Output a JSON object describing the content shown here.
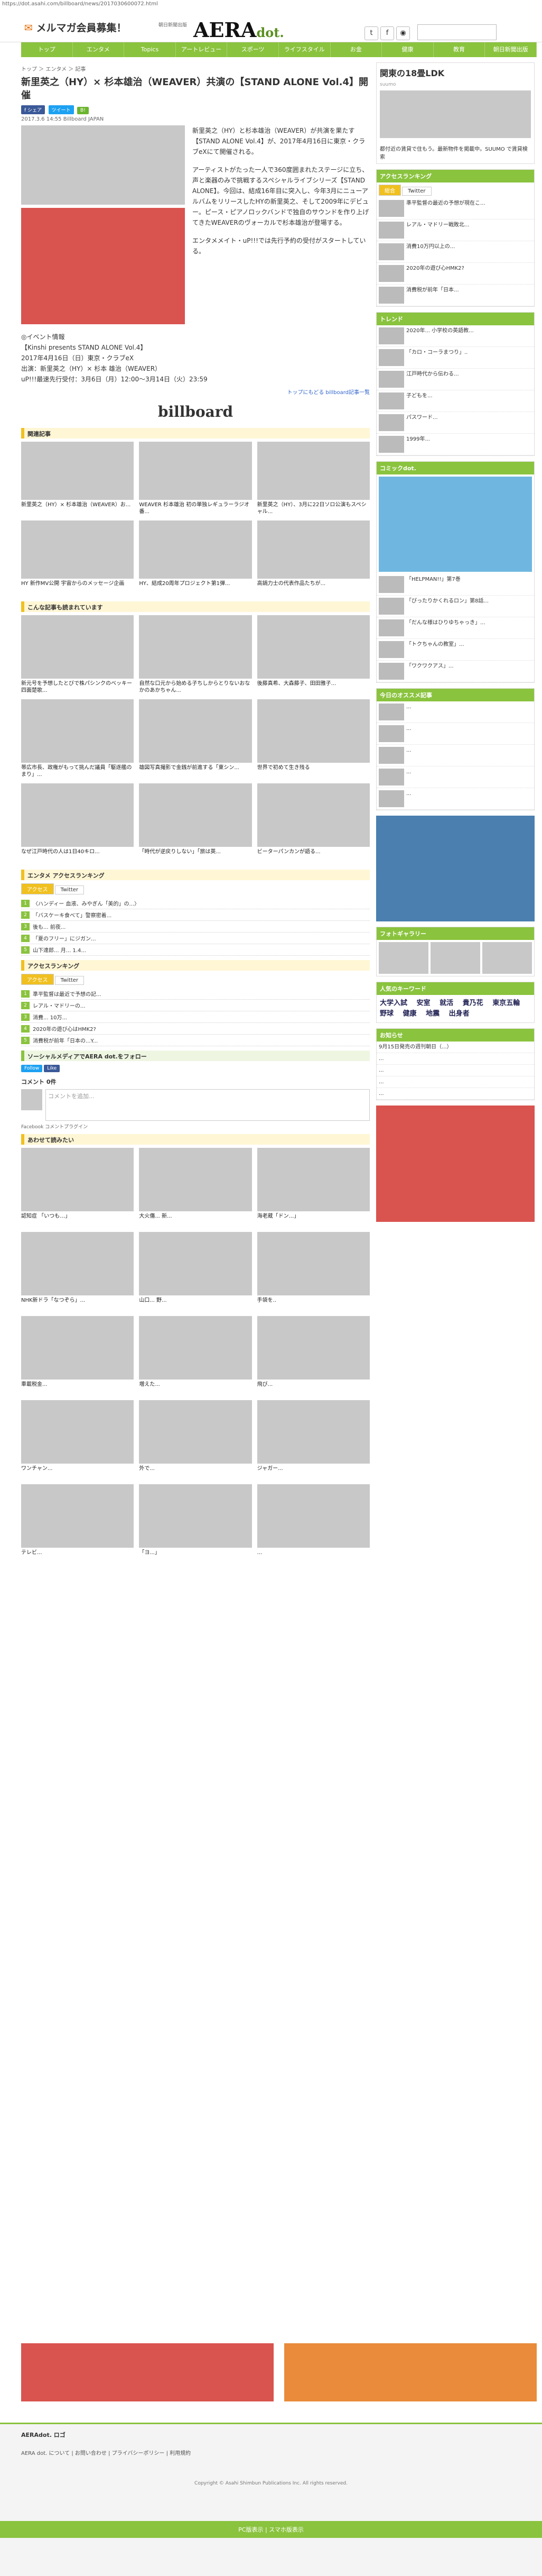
{
  "url": "https://dot.asahi.com/billboard/news/2017030600072.html",
  "header": {
    "mail_logo": "メルマガ会員募集！",
    "mid": "朝日新聞出版",
    "aera": "AERA",
    "dot": "dot."
  },
  "nav": [
    "トップ",
    "エンタメ",
    "Topics",
    "アートレビュー",
    "スポーツ",
    "ライフスタイル",
    "お金",
    "健康",
    "教育",
    "朝日新聞出版"
  ],
  "breadcrumb": "トップ ＞ エンタメ ＞ 記事",
  "article": {
    "title": "新里英之（HY）× 杉本雄治（WEAVER）共演の【STAND ALONE Vol.4】開催",
    "date": "2017.3.6 14:55 Billboard JAPAN",
    "p1": "新里英之（HY）と杉本雄治（WEAVER）が共演を果たす【STAND ALONE Vol.4】が、2017年4月16日に東京・クラブeXにて開催される。",
    "p2": "アーティストがたった一人で360度囲まれたステージに立ち、声と楽器のみで挑戦するスペシャルライブシリーズ【STAND ALONE】。今回は、結成16年目に突入し、今年3月にニューアルバムをリリースしたHYの新里英之、そして2009年にデビュー。ピース・ピアノロックバンドで独自のサウンドを作り上げてきたWEAVERのヴォーカルで杉本雄治が登場する。",
    "p3": "エンタメメイト・uP!!!では先行予約の受付がスタートしている。",
    "info": [
      "◎イベント情報",
      "【Kinshi presents STAND ALONE Vol.4】",
      "2017年4月16日（日）東京・クラブeX",
      "出演：新里英之（HY）× 杉本 雄治（WEAVER）",
      "uP!!!最速先行受付：3月6日（月）12:00〜3月14日（火）23:59"
    ],
    "more": "トップにもどる billboard記事一覧",
    "bb": "billboard"
  },
  "sec_related": "関連記事",
  "related": [
    "新里英之（HY）× 杉本雄治（WEAVER）お...",
    "WEAVER 杉本雄治 初の単独レギュラーラジオ番...",
    "新里英之（HY）、3月に22日ソロ公演もスペシャル...",
    "HY 新作MV公開 宇宙からのメッセージ企画",
    "HY、結成20周年プロジェクト第1弾...",
    "高鍋力士の代表作品たちが..."
  ],
  "sec_recommend": "こんな記事も読まれています",
  "recommend": [
    "新元号を予想したとびで株パシンクのベッキー 四面楚歌...",
    "自然な口元から始める子ちしからとりないおなかのあかちゃん...",
    "後藤真希、大森藤子、田田雅子...",
    "帯広市長、政権がもって挑んだ議員「駆逐艦のまり」...",
    "雄図写真撮影で金銭が前進する「東シン...",
    "世界で初めて生き残る",
    "なぜ江戸時代の人は1日40キロ...",
    "「時代が逆戻りしない」「旅は英...",
    "ビーターパンカンが語る..."
  ],
  "sec_enta_rank": "エンタメ アクセスランキング",
  "enta_tabs": [
    "アクセス",
    "Twitter"
  ],
  "enta_rank": [
    "〈ハンディー 血液、みやぎん「美的」の...〉",
    "「バスケーキ食べて」警察密着...",
    "後も... 前夜... ",
    "「夏のフリー」にジガン...",
    "山下達郎... 月... 1.4..."
  ],
  "sec_rank": "アクセスランキング",
  "rank_tabs": [
    "アクセス",
    "Twitter"
  ],
  "rank": [
    "準平監督は最近で予想の記...",
    "レアル・マドリーの...",
    "消費... 10万...",
    "2020年の遊び心はHMK2?",
    "消費税が前年「日本の...Y..."
  ],
  "sec_follow": "ソーシャルメディアでAERA dot.をフォロー",
  "comments": "コメント 0件",
  "comment_ph": "コメントを追加...",
  "fb": "Facebook コメントプラグイン",
  "sec_ads": "あわせて読みたい",
  "ads": [
    "認知症 「いつも…」",
    "大火傷... 新...",
    "海老蔵「ドン...」",
    "NHK新ドラ「なつぞら」...",
    "山口... 野...",
    "手袋を..",
    "車載税金...",
    "増えた...",
    "飛び...",
    "ワンチャン...",
    "外で...",
    "ジャガー...",
    "テレビ...",
    "「ヨ...」",
    "..."
  ],
  "sidebar": {
    "ad_title": "関東の18畳LDK",
    "ad_sub": "suumo",
    "ad_text": "都付近の賃貸で住もう。最新物件を掲載中。SUUMO で賃貸検索",
    "rank_h": "アクセスランキング",
    "rank_tabs": [
      "総合",
      "Twitter"
    ],
    "rank": [
      "準平監督の最近の予想が現在こ...",
      "レアル・マドリー戦敗北...",
      "消費10万円以上の...",
      "2020年の遊び心HMK2?",
      "消費税が前年「日本..."
    ],
    "trend_h": "トレンド",
    "trend": [
      "2020年... 小学校の英語教...",
      "「カロ・コーラまつり」..",
      "江戸時代から伝わる...",
      "子どもを...",
      "パスワード...",
      "1999年...",
      "早... "
    ],
    "comic_h": "コミックdot.",
    "comic": [
      "「HELPMAN!!」第7巻",
      "「ぴったりかくれるロン」第8話...",
      "「だんな様はひりゆちゃっき」...",
      "「トクちゃんの教室」...",
      "「ワクワクアス」..."
    ],
    "news_h": "今日のオススメ記事",
    "news": [
      "...",
      "...",
      "...",
      "...",
      "..."
    ],
    "photo_h": "フォトギャラリー",
    "kw_h": "人気のキーワード",
    "kw": [
      "大学入試",
      "安室",
      "就活",
      "貴乃花",
      "東京五輪",
      "野球",
      "健康",
      "地震",
      "出身者"
    ],
    "notice_h": "お知らせ",
    "notice": [
      "9月15日発売の週刊朝日（...）",
      "...",
      "...",
      "...",
      "..."
    ]
  },
  "footer": {
    "f1": "AERAdot. ロゴ",
    "links": "AERA dot. について | お問い合わせ | プライバシーポリシー | 利用規約",
    "copy": "Copyright © Asahi Shimbun Publications Inc. All rights reserved.",
    "pc": "PC版表示 | スマホ版表示"
  }
}
